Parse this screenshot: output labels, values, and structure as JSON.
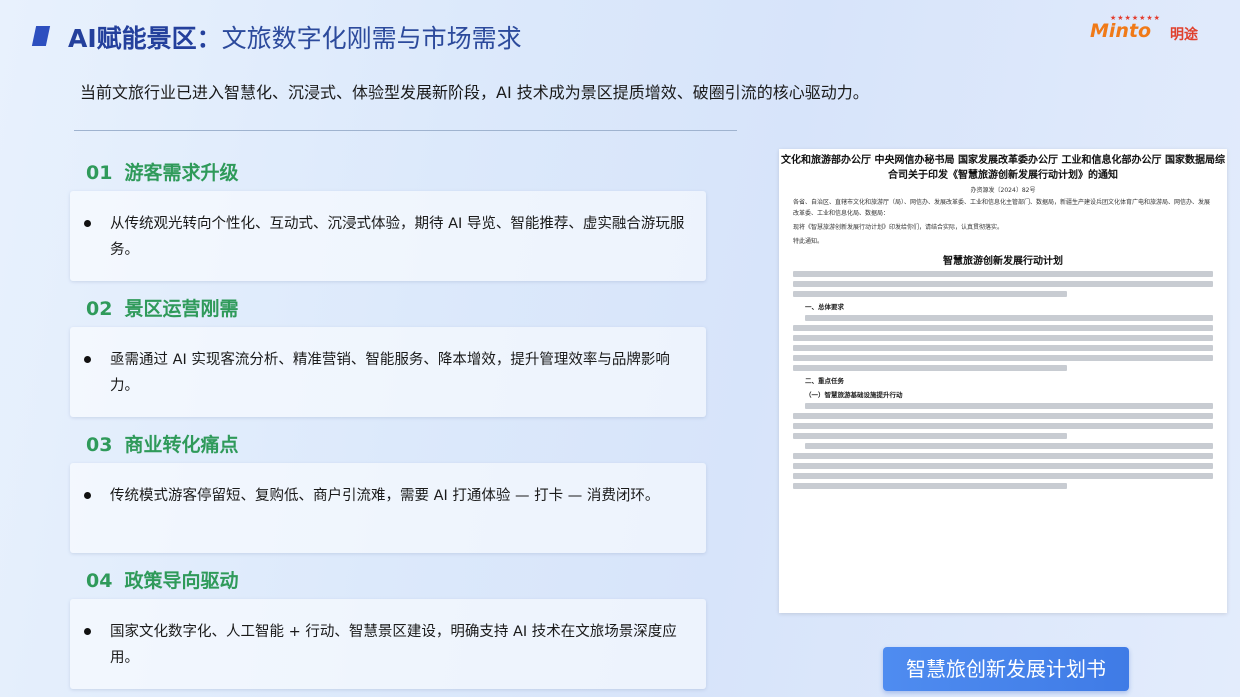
{
  "header": {
    "title_bold": "AI赋能景区：",
    "title_rest": "文旅数字化刚需与市场需求",
    "logo_text": "Minto",
    "logo_cn": "明途"
  },
  "intro": "当前文旅行业已进入智慧化、沉浸式、体验型发展新阶段，AI 技术成为景区提质增效、破圈引流的核心驱动力。",
  "sections": [
    {
      "num": "01",
      "title": "游客需求升级",
      "text": "从传统观光转向个性化、互动式、沉浸式体验，期待 AI 导览、智能推荐、虚实融合游玩服务。"
    },
    {
      "num": "02",
      "title": "景区运营刚需",
      "text": "亟需通过 AI 实现客流分析、精准营销、智能服务、降本增效，提升管理效率与品牌影响力。"
    },
    {
      "num": "03",
      "title": "商业转化痛点",
      "text": "传统模式游客停留短、复购低、商户引流难，需要 AI 打通体验 — 打卡 — 消费闭环。"
    },
    {
      "num": "04",
      "title": "政策导向驱动",
      "text": "国家文化数字化、人工智能 + 行动、智慧景区建设，明确支持 AI 技术在文旅场景深度应用。"
    }
  ],
  "document": {
    "heading": "文化和旅游部办公厅 中央网信办秘书局 国家发展改革委办公厅 工业和信息化部办公厅 国家数据局综合司关于印发《智慧旅游创新发展行动计划》的通知",
    "ref_no": "办资源发〔2024〕82号",
    "recipients": "各省、自治区、直辖市文化和旅游厅（局）、网信办、发展改革委、工业和信息化主管部门、数据局，新疆生产建设兵团文化体育广电和旅游局、网信办、发展改革委、工业和信息化局、数据局：",
    "notice": "现将《智慧旅游创新发展行动计划》印发给你们，请结合实际，认真贯彻落实。",
    "closing": "特此通知。",
    "plan_title": "智慧旅游创新发展行动计划",
    "sec1": "一、总体要求",
    "sec2": "二、重点任务",
    "sec2_1": "（一）智慧旅游基础设施提升行动"
  },
  "button_label": "智慧旅创新发展计划书"
}
